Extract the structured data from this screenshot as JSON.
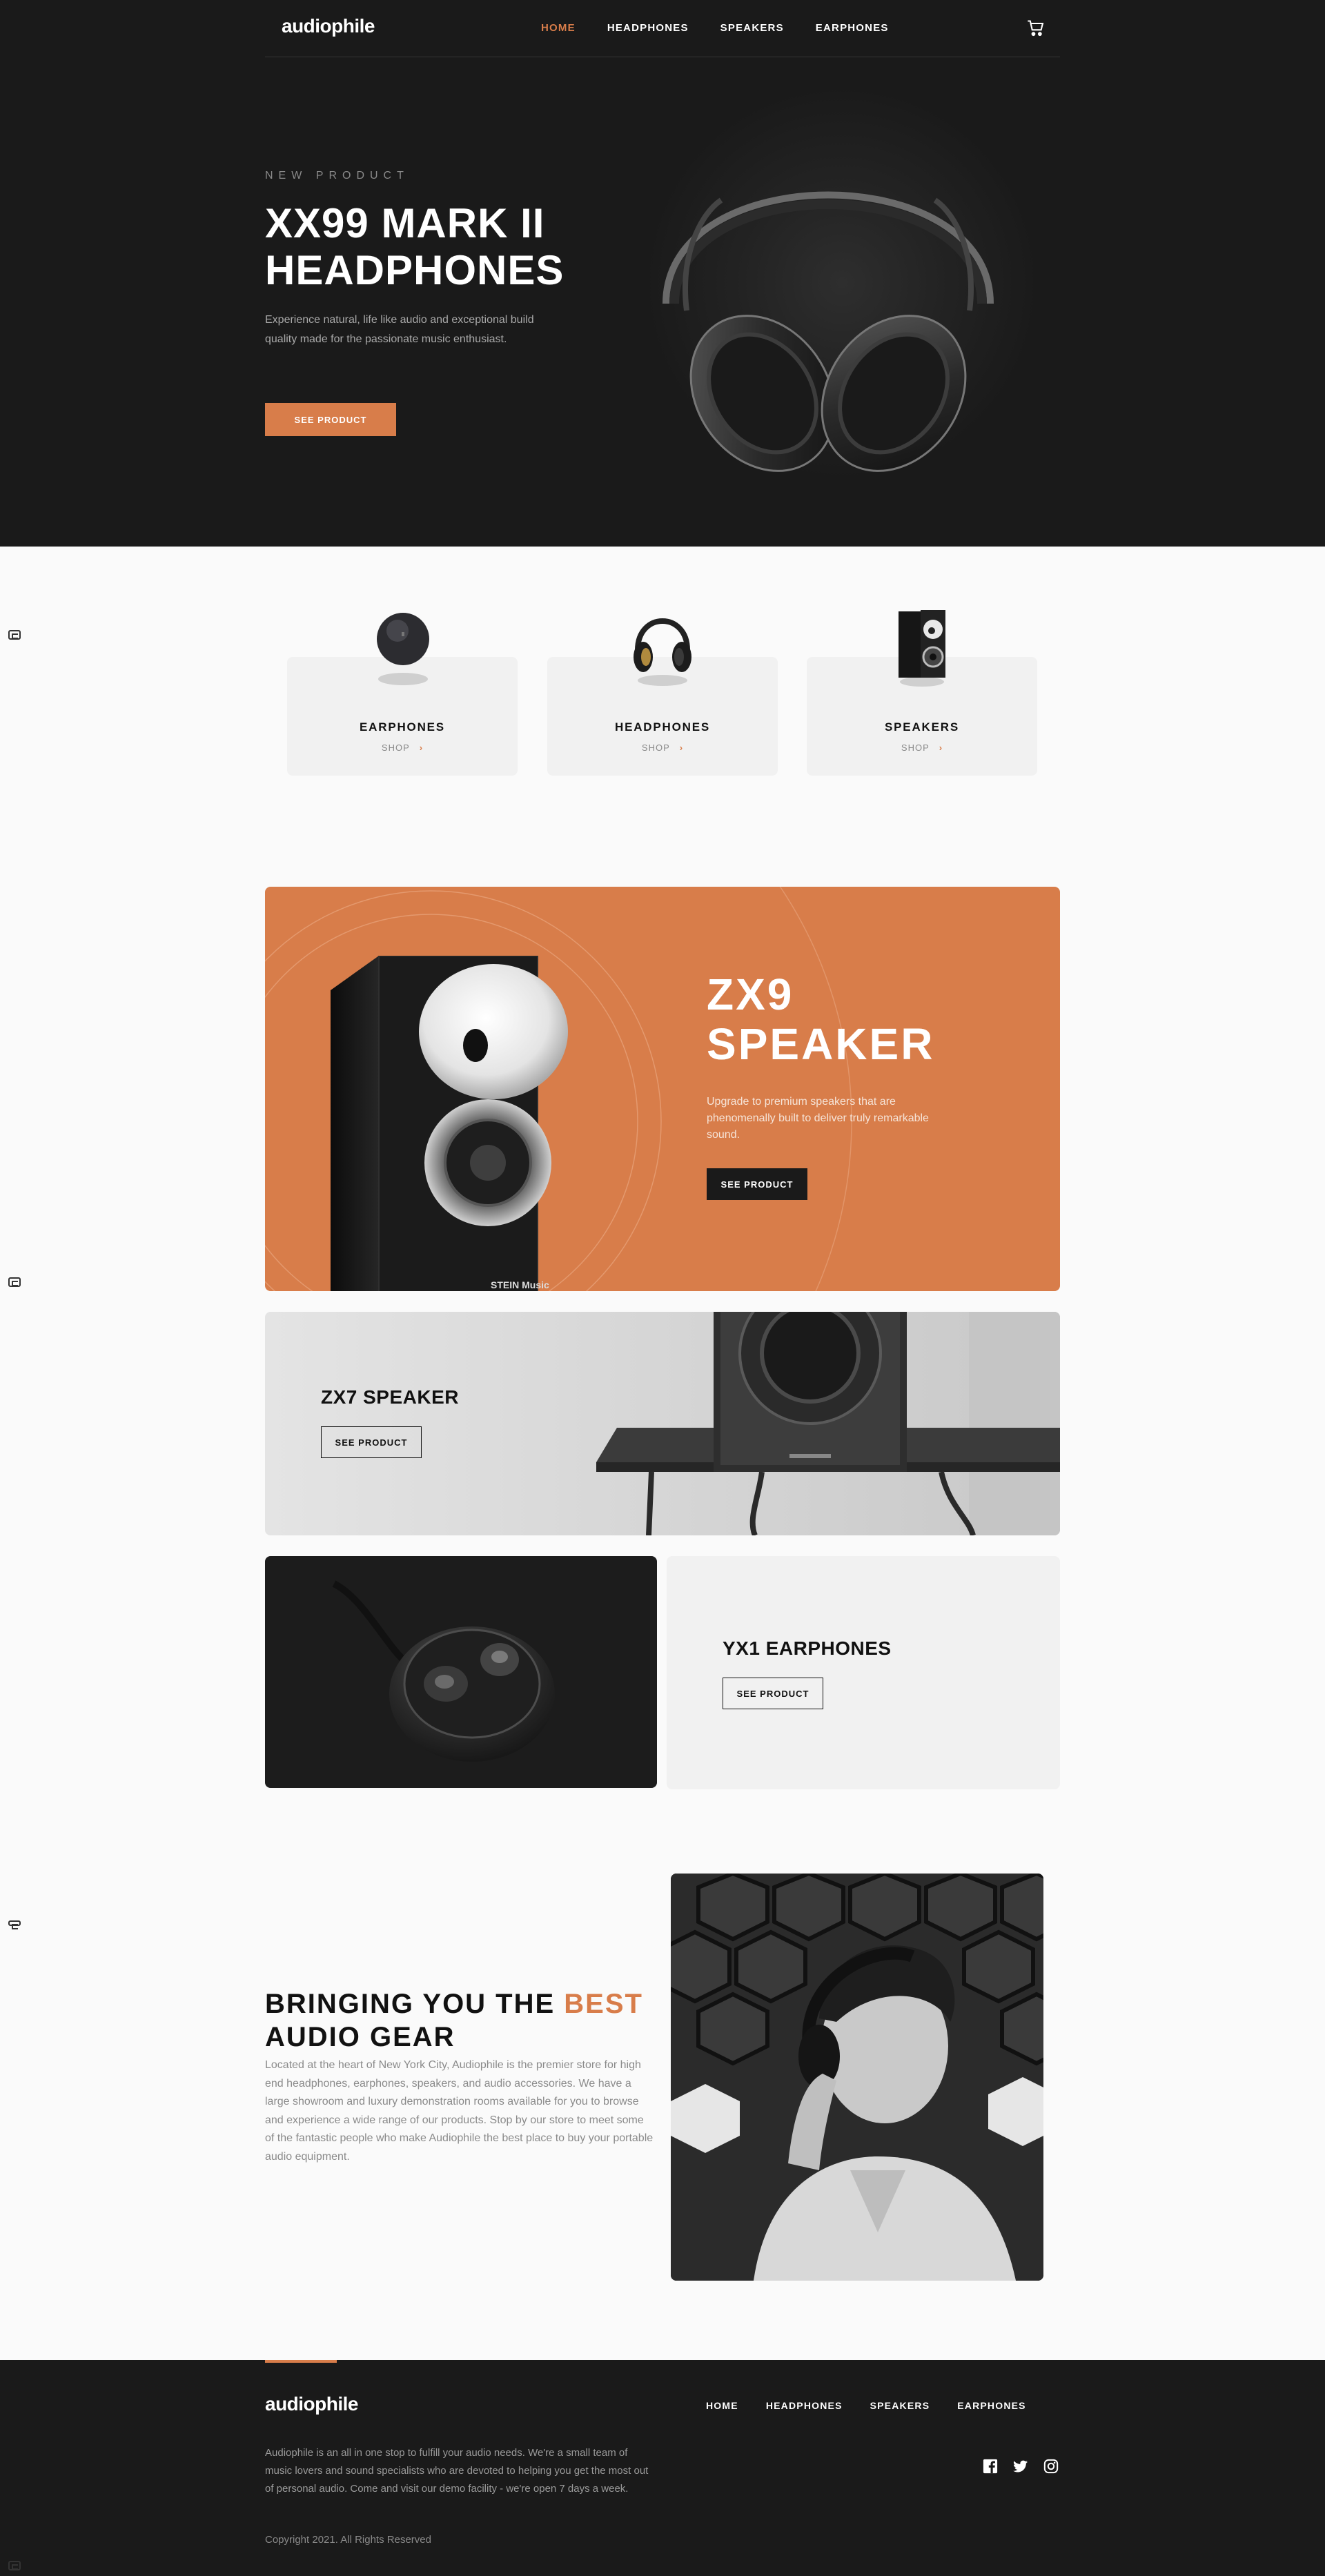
{
  "header": {
    "logo": "audiophile",
    "nav": [
      {
        "label": "HOME",
        "active": true
      },
      {
        "label": "HEADPHONES",
        "active": false
      },
      {
        "label": "SPEAKERS",
        "active": false
      },
      {
        "label": "EARPHONES",
        "active": false
      }
    ],
    "cart_icon": "cart-icon"
  },
  "hero": {
    "eyebrow": "NEW PRODUCT",
    "title": "XX99 MARK II HEADPHONES",
    "description": "Experience natural, life like audio and exceptional build quality made for the passionate music enthusiast.",
    "button": "SEE PRODUCT"
  },
  "categories": [
    {
      "name": "EARPHONES",
      "shop": "SHOP"
    },
    {
      "name": "HEADPHONES",
      "shop": "SHOP"
    },
    {
      "name": "SPEAKERS",
      "shop": "SHOP"
    }
  ],
  "zx9": {
    "title": "ZX9 SPEAKER",
    "description": "Upgrade to premium speakers that are phenomenally built to deliver truly remarkable sound.",
    "button": "SEE PRODUCT",
    "speaker_brand": "STEIN Music"
  },
  "zx7": {
    "title": "ZX7 SPEAKER",
    "button": "SEE PRODUCT"
  },
  "yx1": {
    "title": "YX1 EARPHONES",
    "button": "SEE PRODUCT"
  },
  "about": {
    "title_part1": "BRINGING YOU THE ",
    "title_accent": "BEST",
    "title_part2": " AUDIO GEAR",
    "description": "Located at the heart of New York City, Audiophile is the premier store for high end headphones, earphones, speakers, and audio accessories. We have a large showroom and luxury demonstration rooms available for you to browse and experience a wide range of our products. Stop by our store to meet some of the fantastic people who make Audiophile the best place to buy your portable audio equipment."
  },
  "footer": {
    "logo": "audiophile",
    "nav": [
      "HOME",
      "HEADPHONES",
      "SPEAKERS",
      "EARPHONES"
    ],
    "description": "Audiophile is an all in one stop to fulfill your audio needs. We're a small team of music lovers and sound specialists who are devoted to helping you get the most out of personal audio. Come and visit our demo facility - we're open 7 days a week.",
    "copyright": "Copyright 2021. All Rights Reserved",
    "social_icons": [
      "facebook-icon",
      "twitter-icon",
      "instagram-icon"
    ]
  },
  "colors": {
    "accent": "#d87d4a",
    "dark": "#1a1a1a",
    "light": "#f1f1f1",
    "page": "#fafafa"
  }
}
